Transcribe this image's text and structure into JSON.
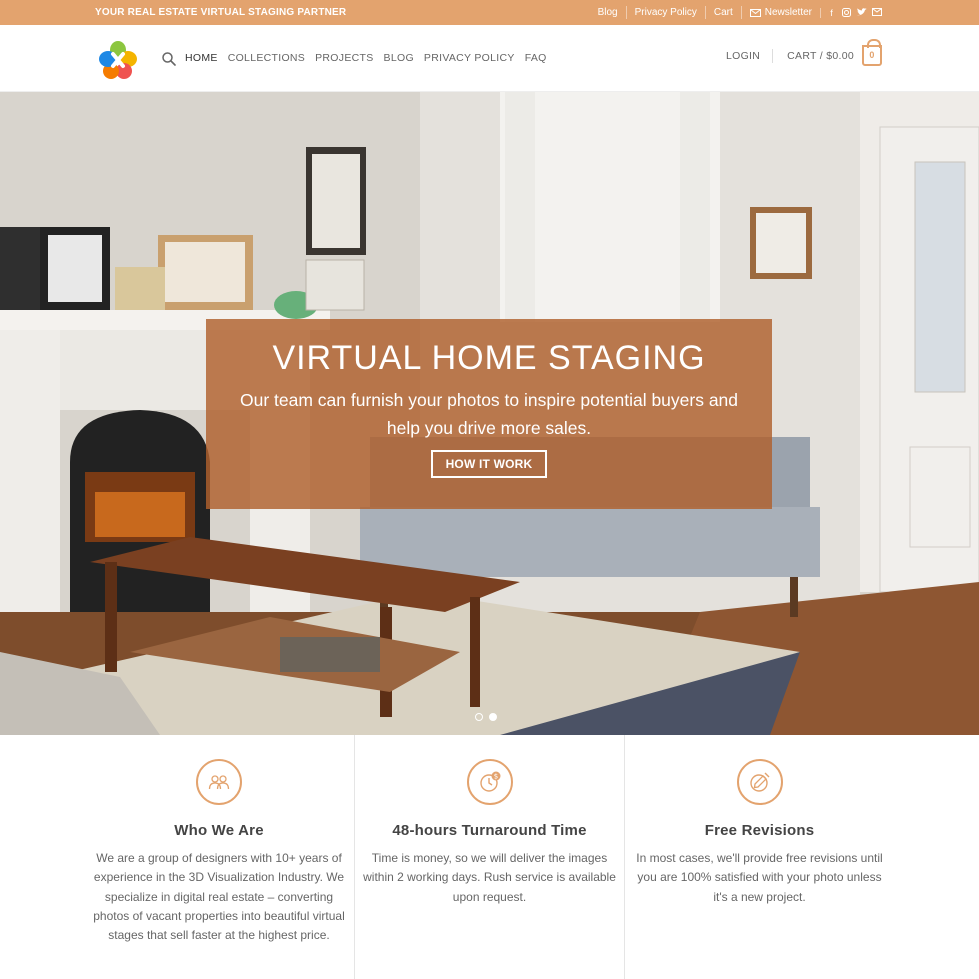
{
  "topbar": {
    "tagline": "YOUR REAL ESTATE VIRTUAL STAGING PARTNER",
    "links": [
      "Blog",
      "Privacy Policy",
      "Cart"
    ],
    "newsletter": "Newsletter",
    "socials": [
      "facebook-icon",
      "instagram-icon",
      "twitter-icon",
      "mail-icon"
    ]
  },
  "header": {
    "nav": [
      "HOME",
      "COLLECTIONS",
      "PROJECTS",
      "BLOG",
      "PRIVACY POLICY",
      "FAQ"
    ],
    "login": "LOGIN",
    "cart": "CART / $0.00",
    "cart_count": "0"
  },
  "hero": {
    "title": "VIRTUAL HOME STAGING",
    "subtitle": "Our team can furnish your photos to inspire potential buyers and help you drive more sales.",
    "button": "HOW IT WORK",
    "slides": 2,
    "active_slide": 2
  },
  "features": [
    {
      "icon": "team-icon",
      "title": "Who We Are",
      "text": "We are a group of designers with 10+ years of experience in the 3D Visualization Industry. We specialize in digital real estate – converting photos of vacant properties into beautiful virtual stages that sell faster at the highest price."
    },
    {
      "icon": "fast-clock-icon",
      "title": "48-hours Turnaround Time",
      "text": "Time is money, so we will deliver the images within 2 working days. Rush service is available upon request."
    },
    {
      "icon": "revision-icon",
      "title": "Free Revisions",
      "text": "In most cases, we'll provide free revisions until you are 100% satisfied with your photo unless it's a new project."
    }
  ],
  "colors": {
    "accent": "#e3a36e",
    "overlay": "#b0602d"
  }
}
